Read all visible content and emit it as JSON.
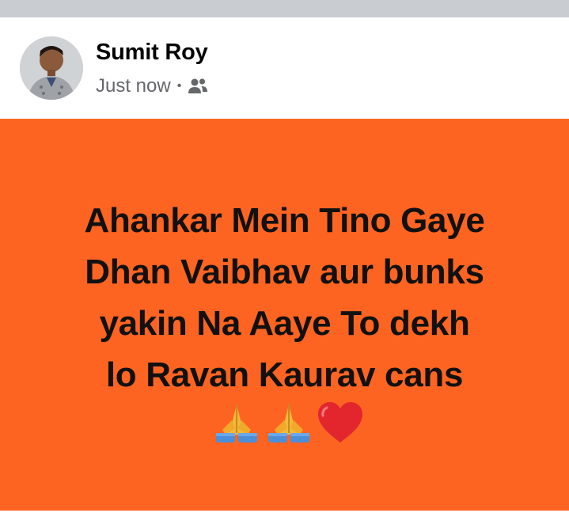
{
  "post": {
    "author": "Sumit Roy",
    "timestamp": "Just now",
    "separator": "•",
    "audience_icon": "friends-icon",
    "background_color": "#fe6421",
    "text_lines": [
      "Ahankar Mein Tino Gaye",
      "Dhan Vaibhav aur bunks",
      "yakin Na Aaye To dekh",
      "lo Ravan Kaurav cans"
    ],
    "emojis": [
      "folded-hands-icon",
      "folded-hands-icon",
      "red-heart-icon"
    ]
  }
}
